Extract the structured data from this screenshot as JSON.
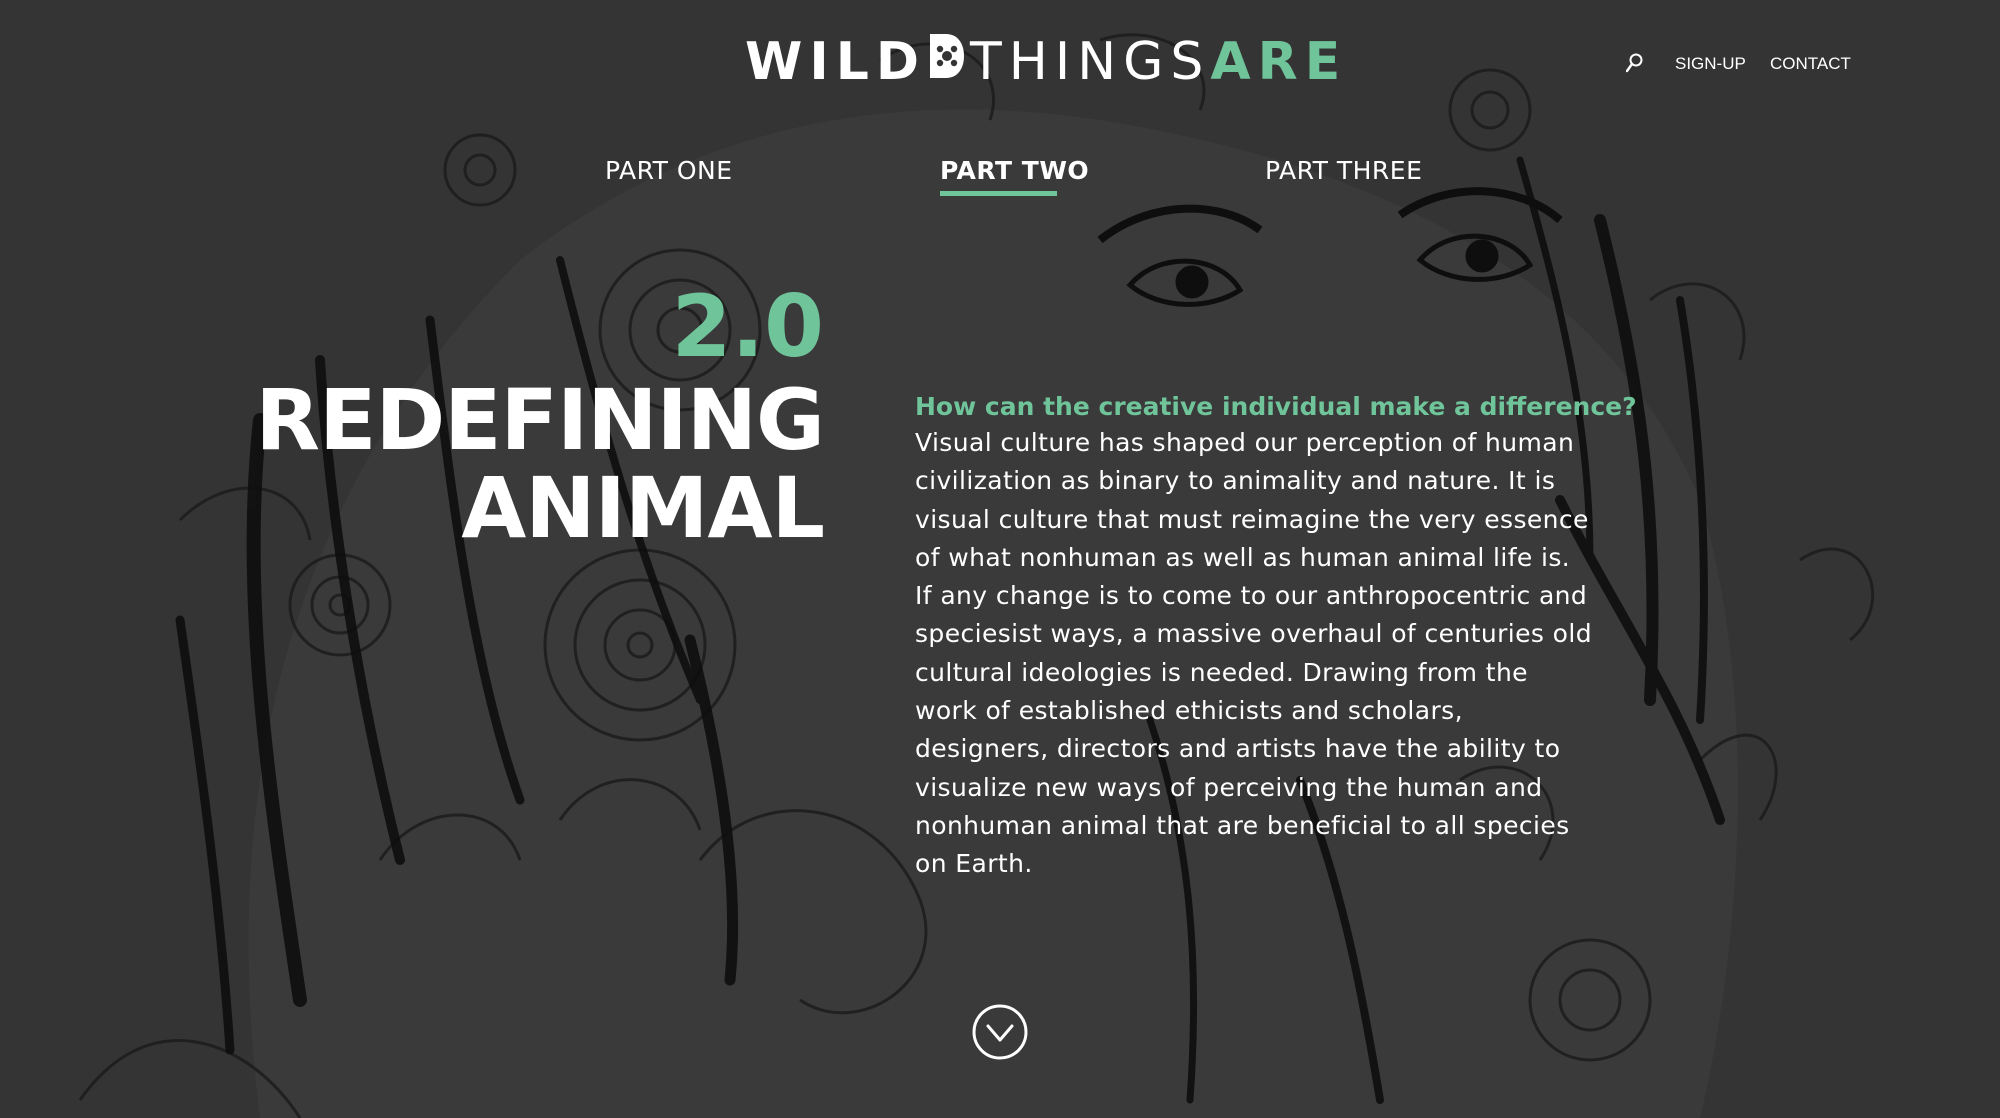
{
  "logo": {
    "wild": "WILD",
    "things": "THINGS",
    "are": "ARE"
  },
  "header": {
    "search_icon": "search-icon",
    "signup": "SIGN-UP",
    "contact": "CONTACT"
  },
  "parts": [
    {
      "label": "PART ONE",
      "active": false
    },
    {
      "label": "PART TWO",
      "active": true
    },
    {
      "label": "PART THREE",
      "active": false
    }
  ],
  "chapter": {
    "number": "2.0",
    "title_line1": "REDEFINING",
    "title_line2": "ANIMAL"
  },
  "content": {
    "question": "How can the creative individual make a difference?",
    "body": "Visual culture has shaped our perception of human civilization as binary to animality and nature. It is visual culture that must reimagine the very essence of what nonhuman as well as human animal life is. If any change is to come to our anthropocentric and speciesist ways, a massive overhaul of centuries old cultural ideologies is needed. Drawing from the work of established ethicists and scholars, designers, directors and artists have the ability to visualize new ways of perceiving the human and nonhuman animal that are beneficial to all species on Earth."
  },
  "scroll_icon": "chevron-down-circle-icon",
  "colors": {
    "background": "#343434",
    "accent": "#6fc49a",
    "text": "#ffffff"
  }
}
